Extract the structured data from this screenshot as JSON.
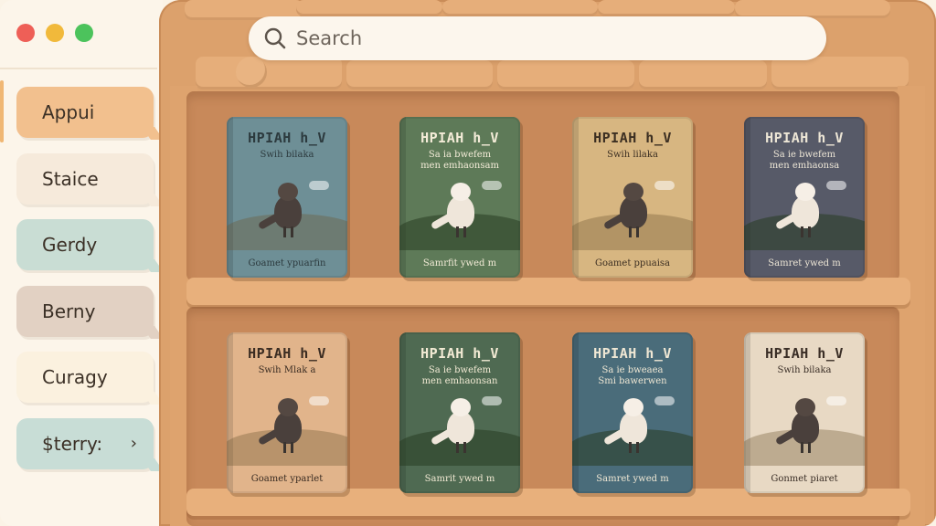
{
  "window": {
    "traffic_lights": [
      "close",
      "minimize",
      "zoom"
    ]
  },
  "sidebar": {
    "items": [
      {
        "label": "Appui",
        "color": "#f2c08e",
        "active": true
      },
      {
        "label": "Staice",
        "color": "#f6eadb"
      },
      {
        "label": "Gerdy",
        "color": "#c9ddd4"
      },
      {
        "label": "Berny",
        "color": "#e2d1c3"
      },
      {
        "label": "Curagy",
        "color": "#fbf1df"
      },
      {
        "label": "$terry:",
        "color": "#c8ddd6",
        "chevron": "›"
      }
    ]
  },
  "search": {
    "placeholder": "Search",
    "icon": "search-icon"
  },
  "books": [
    {
      "title": "HPIAH h_V",
      "subtitle": "Swih bilaka",
      "footer": "Goamet ypuarfin",
      "cover": "#6e8f96",
      "title_color": "#2c3a3e",
      "figure": "dark"
    },
    {
      "title": "HPIAH h_V",
      "subtitle": "Sa ia bwefem\nmen emhaonsam",
      "footer": "Samrfit ywed m",
      "cover": "#5e7a58",
      "title_color": "#f4ecd8",
      "figure": "light"
    },
    {
      "title": "HPIAH h_V",
      "subtitle": "Swih lilaka",
      "footer": "Goamet ppuaisa",
      "cover": "#d7b681",
      "title_color": "#3c2f22",
      "figure": "dark"
    },
    {
      "title": "HPIAH h_V",
      "subtitle": "Sa ie bwefem\nmen emhaonsa",
      "footer": "Samret ywed m",
      "cover": "#575a68",
      "title_color": "#ede6d6",
      "figure": "light"
    },
    {
      "title": "HPIAH h_V",
      "subtitle": "Swih Mlak a",
      "footer": "Goamet yparlet",
      "cover": "#e1b48b",
      "title_color": "#3a2c22",
      "figure": "dark"
    },
    {
      "title": "HPIAH h_V",
      "subtitle": "Sa ie bwefem\nmen emhaonsan",
      "footer": "Samrit ywed m",
      "cover": "#4f6a52",
      "title_color": "#f2ead4",
      "figure": "light"
    },
    {
      "title": "HPIAH h_V",
      "subtitle": "Sa ie bweaea\nSmi bawerwen",
      "footer": "Samret ywed m",
      "cover": "#4a6c7a",
      "title_color": "#efe7d4",
      "figure": "light"
    },
    {
      "title": "HPIAH h_V",
      "subtitle": "Swih bilaka",
      "footer": "Gonmet piaret",
      "cover": "#e8d9c4",
      "title_color": "#3a2e26",
      "figure": "dark"
    }
  ]
}
